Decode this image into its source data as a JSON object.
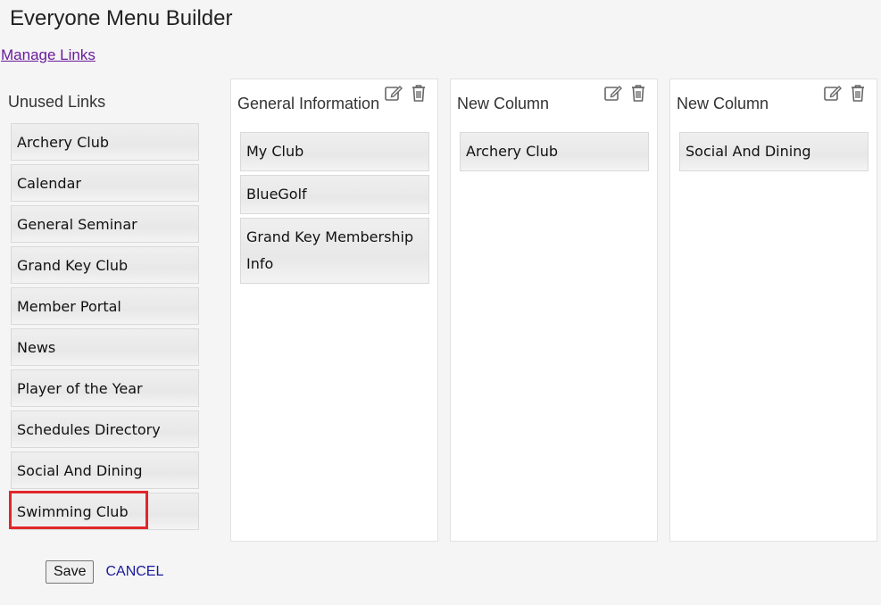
{
  "page": {
    "title": "Everyone Menu Builder",
    "manage_links_label": "Manage Links"
  },
  "unused": {
    "title": "Unused Links",
    "items": [
      {
        "label": "Archery Club"
      },
      {
        "label": "Calendar"
      },
      {
        "label": "General Seminar"
      },
      {
        "label": "Grand Key Club"
      },
      {
        "label": "Member Portal"
      },
      {
        "label": "News"
      },
      {
        "label": "Player of the Year"
      },
      {
        "label": "Schedules Directory"
      },
      {
        "label": "Social And Dining"
      },
      {
        "label": "Swimming Club"
      }
    ]
  },
  "columns": [
    {
      "title": "General Information",
      "links": [
        {
          "label": "My Club"
        },
        {
          "label": "BlueGolf"
        },
        {
          "label": "Grand Key Membership Info"
        }
      ]
    },
    {
      "title": "New Column",
      "links": [
        {
          "label": "Archery Club"
        }
      ]
    },
    {
      "title": "New Column",
      "links": [
        {
          "label": "Social And Dining"
        }
      ]
    }
  ],
  "footer": {
    "save_label": "Save",
    "cancel_label": "CANCEL"
  },
  "icons": {
    "edit": "edit-icon",
    "delete": "trash-icon"
  },
  "colors": {
    "link_purple": "#6b1a9c",
    "cancel_blue": "#1a1a9c",
    "highlight_red": "#e0262a"
  }
}
